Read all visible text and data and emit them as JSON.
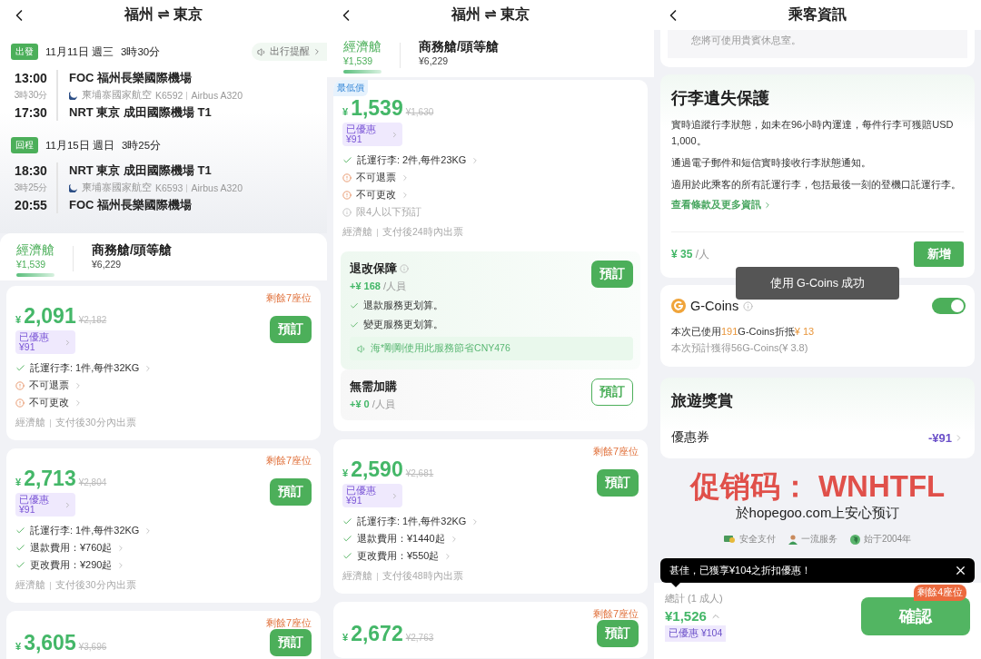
{
  "screens": [
    {
      "kind": "flight_list",
      "header": {
        "title": "福州 ⇌ 東京"
      },
      "itinerary": [
        {
          "tag": "出發",
          "date": "11月11日 週三",
          "duration": "3時30分",
          "reminder": "出行提醒",
          "depart_time": "13:00",
          "leg_duration": "3時30分",
          "arrive_time": "17:30",
          "origin": "FOC 福州長樂國際機場",
          "airline": "柬埔寨國家航空",
          "flight_no": "K6592",
          "aircraft": "Airbus A320",
          "destination": "NRT 東京 成田國際機場 T1"
        },
        {
          "tag": "回程",
          "date": "11月15日 週日",
          "duration": "3時25分",
          "depart_time": "18:30",
          "leg_duration": "3時25分",
          "arrive_time": "20:55",
          "origin": "NRT 東京 成田國際機場 T1",
          "airline": "柬埔寨國家航空",
          "flight_no": "K6593",
          "aircraft": "Airbus A320",
          "destination": "FOC 福州長樂國際機場"
        }
      ],
      "cabin_tabs": [
        {
          "name": "經濟艙",
          "price": "¥1,539",
          "selected": true
        },
        {
          "name": "商務艙/頭等艙",
          "price": "¥6,229",
          "selected": false
        }
      ],
      "fares": [
        {
          "seats_left": "剩餘7座位",
          "currency": "¥",
          "price": "2,091",
          "original_price": "¥2,182",
          "discount": {
            "label": "已優惠",
            "amount": "¥91"
          },
          "book": "預訂",
          "perks": [
            {
              "kind": "included",
              "text": "託運行李: 1件,每件32KG"
            },
            {
              "kind": "warning",
              "text": "不可退票"
            },
            {
              "kind": "warning",
              "text": "不可更改"
            }
          ],
          "footer": {
            "cabin": "經濟艙",
            "note": "支付後30分內出票"
          }
        },
        {
          "seats_left": "剩餘7座位",
          "currency": "¥",
          "price": "2,713",
          "original_price": "¥2,804",
          "discount": {
            "label": "已優惠",
            "amount": "¥91"
          },
          "book": "預訂",
          "perks": [
            {
              "kind": "included",
              "text": "託運行李: 1件,每件32KG"
            },
            {
              "kind": "included",
              "text": "退款費用：¥760起"
            },
            {
              "kind": "included",
              "text": "更改費用：¥290起"
            }
          ],
          "footer": {
            "cabin": "經濟艙",
            "note": "支付後30分內出票"
          }
        },
        {
          "seats_left": "剩餘7座位",
          "currency": "¥",
          "price": "3,605",
          "original_price": "¥3,696",
          "book": "預訂"
        }
      ]
    },
    {
      "kind": "flight_list",
      "header": {
        "title": "福州 ⇌ 東京"
      },
      "cabin_tabs": [
        {
          "name": "經濟艙",
          "price": "¥1,539",
          "selected": true
        },
        {
          "name": "商務艙/頭等艙",
          "price": "¥6,229",
          "selected": false
        }
      ],
      "fares": [
        {
          "lowest_tag": "最低價",
          "currency": "¥",
          "price": "1,539",
          "original_price": "¥1,630",
          "discount": {
            "label": "已優惠",
            "amount": "¥91"
          },
          "perks": [
            {
              "kind": "included",
              "text": "託運行李: 2件,每件23KG"
            },
            {
              "kind": "warning",
              "text": "不可退票"
            },
            {
              "kind": "warning",
              "text": "不可更改"
            },
            {
              "kind": "info",
              "text": "限4人以下預訂"
            }
          ],
          "footer": {
            "cabin": "經濟艙",
            "note": "支付後24時內出票"
          },
          "addons": [
            {
              "title": "退改保障",
              "price": "+¥ 168",
              "unit": "/人員",
              "points": [
                "退款服務更划算。",
                "變更服務更划算。"
              ],
              "notice": "海*剛剛使用此服務節省CNY476",
              "book": "預訂",
              "selected": true
            },
            {
              "title": "無需加購",
              "price": "+¥ 0",
              "unit": "/人員",
              "book": "預訂",
              "selected": false
            }
          ]
        },
        {
          "seats_left": "剩餘7座位",
          "currency": "¥",
          "price": "2,590",
          "original_price": "¥2,681",
          "discount": {
            "label": "已優惠",
            "amount": "¥91"
          },
          "book": "預訂",
          "perks": [
            {
              "kind": "included",
              "text": "託運行李: 1件,每件32KG"
            },
            {
              "kind": "included",
              "text": "退款費用：¥1440起"
            },
            {
              "kind": "included",
              "text": "更改費用：¥550起"
            }
          ],
          "footer": {
            "cabin": "經濟艙",
            "note": "支付後48時內出票"
          }
        },
        {
          "seats_left": "剩餘7座位",
          "currency": "¥",
          "price": "2,672",
          "original_price": "¥2,763",
          "book": "預訂"
        }
      ]
    },
    {
      "kind": "passenger_info",
      "header": {
        "title": "乘客資訊"
      },
      "lounge_note": "您將可使用貴賓休息室。",
      "baggage": {
        "title": "行李遺失保護",
        "paragraphs": [
          "實時追蹤行李狀態，如未在96小時內運達，每件行李可獲賠USD 1,000。",
          "通過電子郵件和短信實時接收行李狀態通知。",
          "適用於此乘客的所有託運行李，包括最後一刻的登機口託運行李。"
        ],
        "link": "查看條款及更多資訊",
        "price": "¥ 35",
        "unit": "/人",
        "add": "新增"
      },
      "toast": "使用 G-Coins 成功",
      "gcoins": {
        "title": "G-Coins",
        "on": true,
        "used_prefix": "本次已使用",
        "used_count": "191",
        "used_middle": "G-Coins折抵",
        "used_amount": "¥ 13",
        "earned": "本次預計獲得56G-Coins(¥ 3.8)"
      },
      "rewards": {
        "title": "旅遊獎賞",
        "label": "優惠券",
        "value": "-¥91"
      },
      "promo": {
        "code": "促销码： WNHTFL",
        "site": "於hopegoo.com上安心预订"
      },
      "trust": [
        {
          "kind": "payment",
          "text": "安全支付"
        },
        {
          "kind": "service",
          "text": "一流服务"
        },
        {
          "kind": "globe",
          "text": "始于2004年"
        }
      ],
      "tooltip": "甚佳，已獲享¥104之折扣優惠！",
      "footer": {
        "total_label": "總計 (1 成人)",
        "total": "¥1,526",
        "discount": "已優惠 ¥104",
        "seats_left": "剩餘4座位",
        "confirm": "確認"
      }
    }
  ]
}
